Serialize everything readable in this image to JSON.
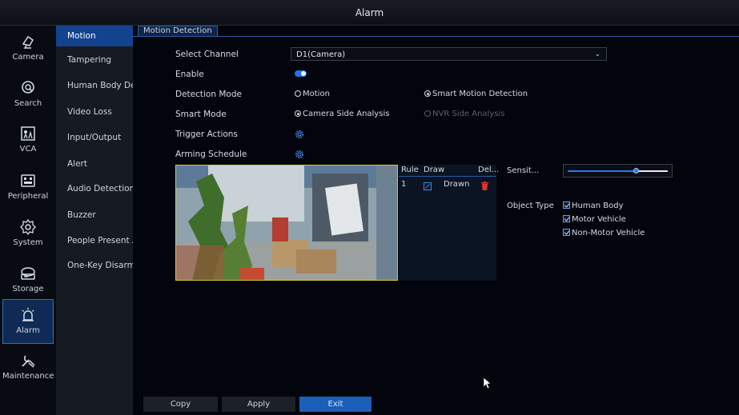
{
  "window": {
    "title": "Alarm"
  },
  "left_nav": [
    {
      "label": "Camera",
      "icon": "camera-icon"
    },
    {
      "label": "Search",
      "icon": "search-icon"
    },
    {
      "label": "VCA",
      "icon": "vca-icon"
    },
    {
      "label": "Peripheral",
      "icon": "peripheral-icon"
    },
    {
      "label": "System",
      "icon": "gear-icon"
    },
    {
      "label": "Storage",
      "icon": "storage-icon"
    },
    {
      "label": "Alarm",
      "icon": "alarm-icon",
      "active": true
    },
    {
      "label": "Maintenance",
      "icon": "wrench-icon"
    }
  ],
  "sub_nav": [
    {
      "label": "Motion",
      "active": true
    },
    {
      "label": "Tampering"
    },
    {
      "label": "Human Body Det..."
    },
    {
      "label": "Video Loss"
    },
    {
      "label": "Input/Output"
    },
    {
      "label": "Alert"
    },
    {
      "label": "Audio Detection"
    },
    {
      "label": "Buzzer"
    },
    {
      "label": "People Present A..."
    },
    {
      "label": "One-Key Disarmi..."
    }
  ],
  "tab": {
    "label": "Motion Detection"
  },
  "form": {
    "select_channel_label": "Select Channel",
    "select_channel_value": "D1(Camera)",
    "enable_label": "Enable",
    "enable_on": true,
    "detection_mode_label": "Detection Mode",
    "detection_mode_options": [
      "Motion",
      "Smart Motion Detection"
    ],
    "detection_mode_selected": "Smart Motion Detection",
    "smart_mode_label": "Smart Mode",
    "smart_mode_options": [
      "Camera Side Analysis",
      "NVR Side Analysis"
    ],
    "smart_mode_selected": "Camera Side Analysis",
    "trigger_actions_label": "Trigger Actions",
    "arming_schedule_label": "Arming Schedule"
  },
  "rules_table": {
    "headers": {
      "rule": "Rule",
      "draw": "Draw",
      "delete": "Del..."
    },
    "rows": [
      {
        "rule": "1",
        "draw": "Drawn"
      }
    ]
  },
  "sensitivity": {
    "label": "Sensit...",
    "level_fraction": 0.68
  },
  "object_type": {
    "label": "Object Type",
    "options": [
      {
        "label": "Human Body",
        "checked": true
      },
      {
        "label": "Motor Vehicle",
        "checked": true
      },
      {
        "label": "Non-Motor Vehicle",
        "checked": true
      }
    ]
  },
  "buttons": {
    "copy": "Copy",
    "apply": "Apply",
    "exit": "Exit"
  },
  "colors": {
    "accent": "#1b5fb8",
    "toggle_on": "#1e74e6",
    "delete_icon": "#e0322b",
    "video_border": "#d8c63a"
  }
}
